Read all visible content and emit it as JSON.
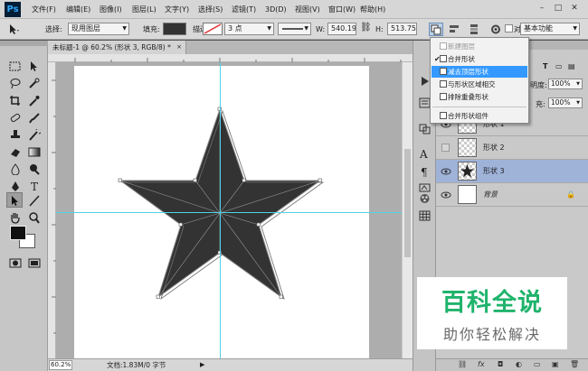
{
  "menubar": {
    "logo": "Ps",
    "items": [
      "文件(F)",
      "编辑(E)",
      "图像(I)",
      "图层(L)",
      "文字(Y)",
      "选择(S)",
      "滤镜(T)",
      "3D(D)",
      "视图(V)",
      "窗口(W)",
      "帮助(H)"
    ]
  },
  "options": {
    "select_label": "选择:",
    "select_value": "现用图层",
    "fill_label": "填充:",
    "stroke_label": "描边:",
    "stroke_width": "3 点",
    "w_label": "W:",
    "w_value": "540.19",
    "h_label": "H:",
    "h_value": "513.75",
    "align_edges_label": "对",
    "workspace": "基本功能"
  },
  "document": {
    "tab_title": "未标题-1 @ 60.2% (形状 3, RGB/8) *",
    "close": "×",
    "zoom": "60.2%",
    "doc_info": "文档:1.83M/0 字节"
  },
  "path_ops_menu": {
    "items": [
      {
        "label": "新建图层",
        "disabled": true,
        "checked": false,
        "highlight": false
      },
      {
        "label": "合并形状",
        "disabled": false,
        "checked": true,
        "highlight": false
      },
      {
        "label": "减去顶层形状",
        "disabled": false,
        "checked": false,
        "highlight": true
      },
      {
        "label": "与形状区域相交",
        "disabled": false,
        "checked": false,
        "highlight": false
      },
      {
        "label": "排除重叠形状",
        "disabled": false,
        "checked": false,
        "highlight": false
      },
      {
        "label": "合并形状组件",
        "disabled": false,
        "checked": false,
        "highlight": false
      }
    ],
    "check_mark": "✔"
  },
  "layers_panel": {
    "opacity_label": "明度:",
    "opacity_value": "100%",
    "fill_label": "充:",
    "fill_value": "100%",
    "layers": [
      {
        "name": "形状 1",
        "visible": true,
        "selected": false
      },
      {
        "name": "形状 2",
        "visible": false,
        "selected": false
      },
      {
        "name": "形状 3",
        "visible": true,
        "selected": true
      },
      {
        "name": "背景",
        "visible": true,
        "selected": false,
        "locked": true
      }
    ]
  },
  "watermark": {
    "title": "百科全说",
    "subtitle": "助你轻松解决"
  },
  "colors": {
    "shape_fill": "#333333",
    "guide": "#4fd3e6",
    "menu_highlight": "#3399ff",
    "layer_selected": "#9fb3d9",
    "watermark_green": "#1fb36b"
  }
}
